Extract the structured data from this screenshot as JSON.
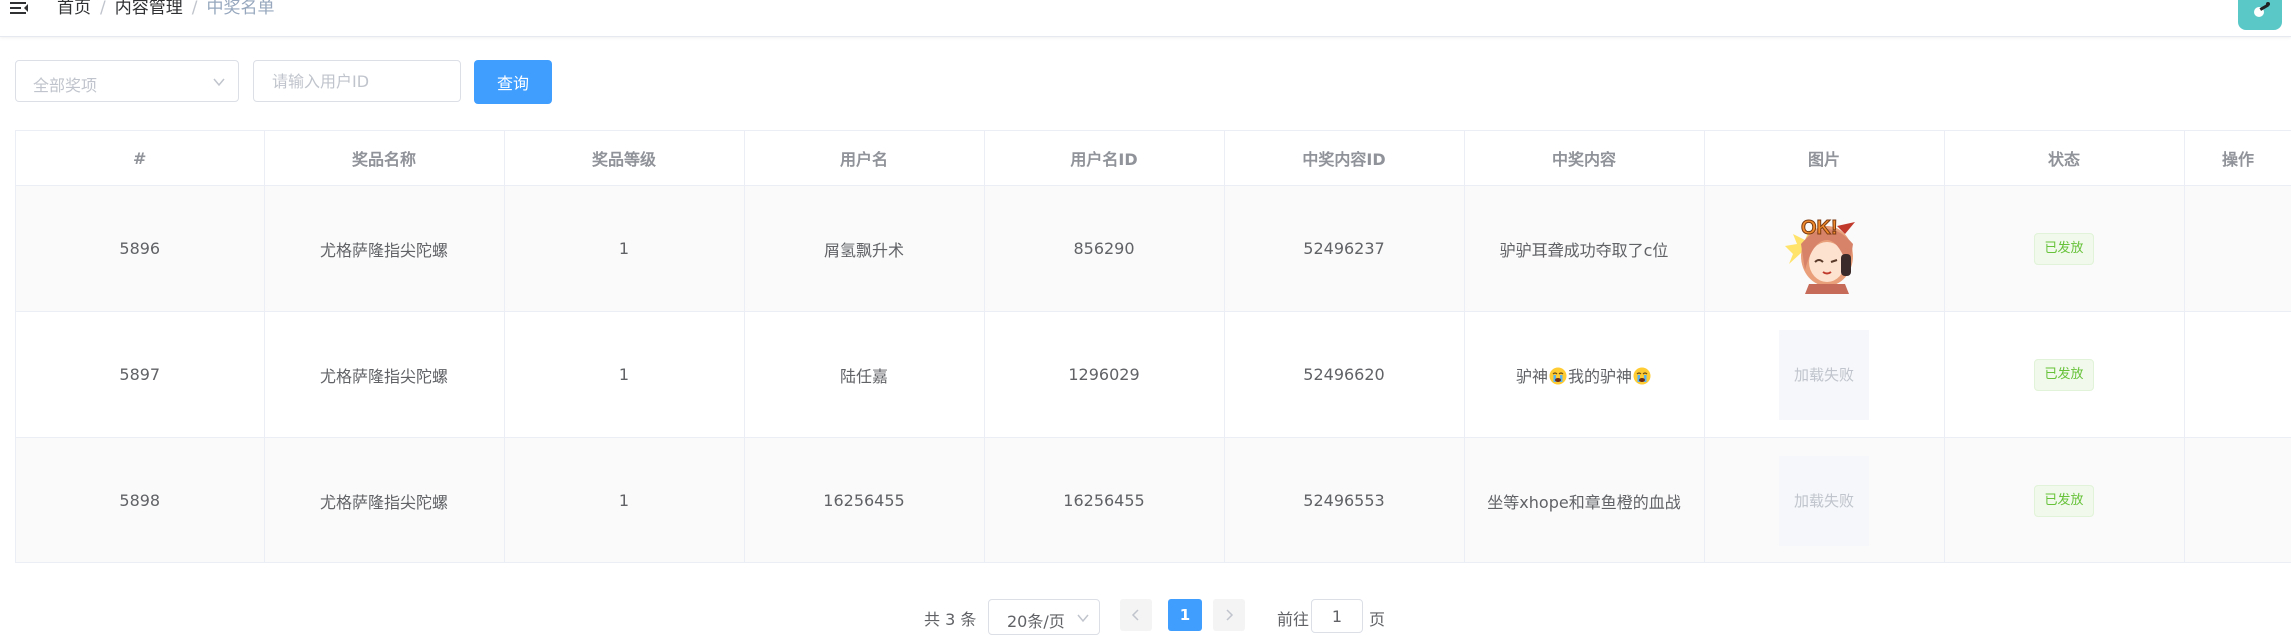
{
  "header": {
    "breadcrumb": [
      "首页",
      "内容管理",
      "中奖名单"
    ],
    "separator": "/"
  },
  "filters": {
    "prize_select_placeholder": "全部奖项",
    "user_id_placeholder": "请输入用户ID",
    "query_label": "查询"
  },
  "table": {
    "columns": [
      "#",
      "奖品名称",
      "奖品等级",
      "用户名",
      "用户名ID",
      "中奖内容ID",
      "中奖内容",
      "图片",
      "状态",
      "操作"
    ],
    "rows": [
      {
        "id": "5896",
        "prize_name": "尤格萨隆指尖陀螺",
        "prize_level": "1",
        "username": "屑氢飘升术",
        "user_id": "856290",
        "content_id": "52496237",
        "content": "驴驴耳聋成功夺取了c位",
        "image": "ok-sticker",
        "image_fail_text": "",
        "status": "已发放"
      },
      {
        "id": "5897",
        "prize_name": "尤格萨隆指尖陀螺",
        "prize_level": "1",
        "username": "陆任嘉",
        "user_id": "1296029",
        "content_id": "52496620",
        "content_parts": [
          "驴神",
          "我的驴神"
        ],
        "image": "failed",
        "image_fail_text": "加载失败",
        "status": "已发放"
      },
      {
        "id": "5898",
        "prize_name": "尤格萨隆指尖陀螺",
        "prize_level": "1",
        "username": "16256455",
        "user_id": "16256455",
        "content_id": "52496553",
        "content": "坐等xhope和章鱼橙的血战",
        "image": "failed",
        "image_fail_text": "加载失败",
        "status": "已发放"
      }
    ]
  },
  "pagination": {
    "total_text": "共 3 条",
    "page_size": "20条/页",
    "current_page": "1",
    "goto_prefix": "前往",
    "goto_value": "1",
    "goto_suffix": "页"
  },
  "colors": {
    "primary": "#409eff",
    "success_tag_text": "#67c23a",
    "success_tag_bg": "#f0f9eb",
    "avatar_bg": "#5bc8c8"
  },
  "icons": [
    "hamburger-icon",
    "chevron-down-icon",
    "chevron-left-icon",
    "chevron-right-icon",
    "crying-emoji-icon"
  ]
}
